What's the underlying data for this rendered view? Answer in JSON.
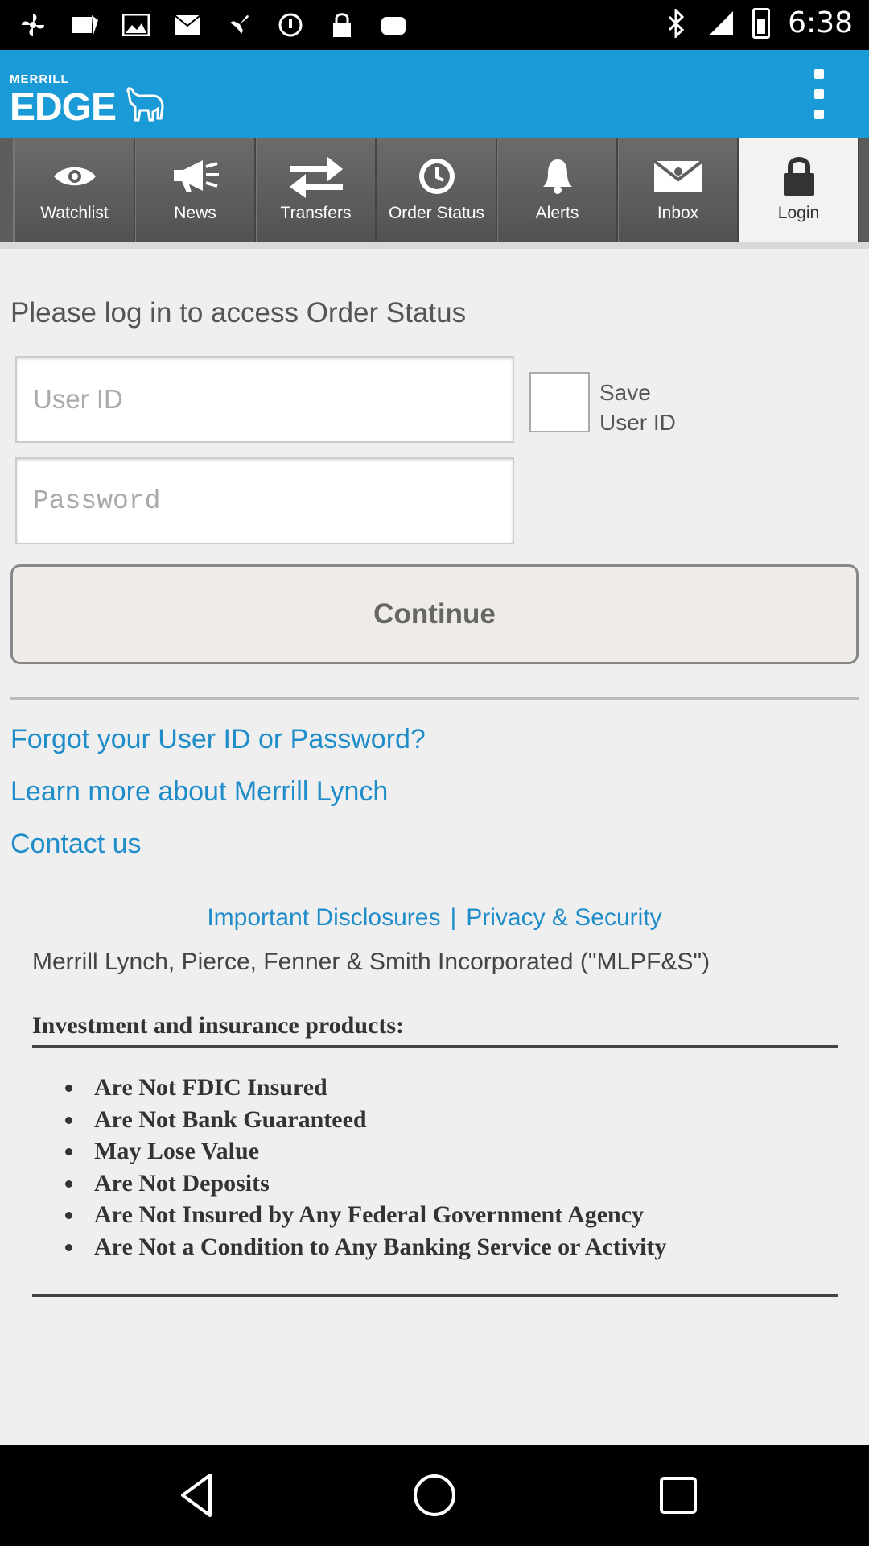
{
  "status_bar": {
    "time": "6:38",
    "left_icons": [
      "fan-icon",
      "airplane-news-icon",
      "image-icon",
      "mail-icon",
      "airplane-icon",
      "circle-icon",
      "lock-icon",
      "cloud-icon"
    ],
    "right_icons": [
      "bluetooth-icon",
      "signal-icon",
      "battery-icon"
    ]
  },
  "header": {
    "logo_small": "MERRILL",
    "logo_big": "EDGE",
    "brand_color": "#1a9bd7"
  },
  "nav": {
    "tabs": [
      {
        "label": "Watchlist",
        "icon": "eye-icon"
      },
      {
        "label": "News",
        "icon": "megaphone-icon"
      },
      {
        "label": "Transfers",
        "icon": "transfer-arrows-icon"
      },
      {
        "label": "Order Status",
        "icon": "clock-icon"
      },
      {
        "label": "Alerts",
        "icon": "bell-icon"
      },
      {
        "label": "Inbox",
        "icon": "envelope-icon"
      },
      {
        "label": "Login",
        "icon": "lock-icon",
        "active": true
      }
    ]
  },
  "login": {
    "prompt": "Please log in to access Order Status",
    "user_id_placeholder": "User ID",
    "user_id_value": "",
    "password_placeholder": "Password",
    "password_value": "",
    "save_user_id_label_line1": "Save",
    "save_user_id_label_line2": "User ID",
    "save_user_id_checked": false,
    "continue_label": "Continue"
  },
  "links": {
    "forgot": "Forgot your User ID or Password?",
    "learn_more": "Learn more about Merrill Lynch",
    "contact": "Contact us",
    "link_color": "#1f8dc9"
  },
  "footer": {
    "disclosures": "Important Disclosures",
    "separator": "|",
    "privacy": "Privacy & Security",
    "company": "Merrill Lynch, Pierce, Fenner & Smith Incorporated (\"MLPF&S\")",
    "investment_title": "Investment and insurance products:",
    "items": [
      "Are Not FDIC Insured",
      "Are Not Bank Guaranteed",
      "May Lose Value",
      "Are Not Deposits",
      "Are Not Insured by Any Federal Government Agency",
      "Are Not a Condition to Any Banking Service or Activity"
    ]
  },
  "system_nav": {
    "buttons": [
      "back-icon",
      "home-icon",
      "recents-icon"
    ]
  }
}
